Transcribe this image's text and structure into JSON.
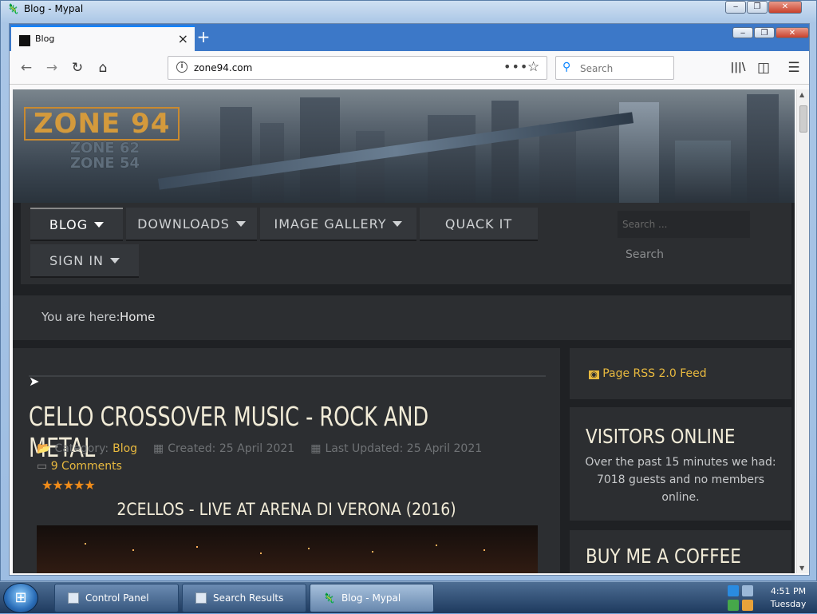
{
  "outer_window": {
    "title": "Blog - Mypal",
    "min": "‒",
    "max": "❐",
    "close": "✕"
  },
  "browser": {
    "tab": {
      "title": "Blog",
      "close": "×"
    },
    "new_tab": "+",
    "url": "zone94.com",
    "search_placeholder": "Search",
    "url_more": "•••",
    "nav": {
      "back": "←",
      "forward": "→",
      "reload": "↻",
      "home": "⌂",
      "library": "|||\\",
      "sidebar": "◫",
      "menu": "☰"
    }
  },
  "site": {
    "logo": {
      "main": "ZONE 94",
      "sub1": "ZONE 62",
      "sub2": "ZONE 54"
    },
    "menu": [
      {
        "label": "BLOG",
        "caret": true
      },
      {
        "label": "DOWNLOADS",
        "caret": true
      },
      {
        "label": "IMAGE GALLERY",
        "caret": true
      },
      {
        "label": "QUACK IT",
        "caret": false
      },
      {
        "label": "SIGN IN",
        "caret": true
      }
    ],
    "search_placeholder": "Search ...",
    "search_button": "Search",
    "breadcrumb": {
      "label": "You are here:",
      "home": "Home"
    },
    "article": {
      "title": "CELLO CROSSOVER MUSIC - ROCK AND METAL",
      "category_label": "Category:",
      "category": "Blog",
      "created": "Created: 25 April 2021",
      "updated": "Last Updated: 25 April 2021",
      "comments": "9 Comments",
      "stars": "★★★★★",
      "video_title": "2CELLOS - LIVE AT ARENA DI VERONA (2016)"
    },
    "sidebar": {
      "rss": "Page RSS 2.0 Feed",
      "visitors_heading": "VISITORS ONLINE",
      "visitors_text": "Over the past 15 minutes we had: 7018 guests and no members online.",
      "coffee_heading": "BUY ME A COFFEE"
    }
  },
  "taskbar": {
    "items": [
      {
        "label": "Control Panel"
      },
      {
        "label": "Search Results"
      },
      {
        "label": "Blog - Mypal"
      }
    ],
    "time": "4:51 PM",
    "day": "Tuesday"
  }
}
